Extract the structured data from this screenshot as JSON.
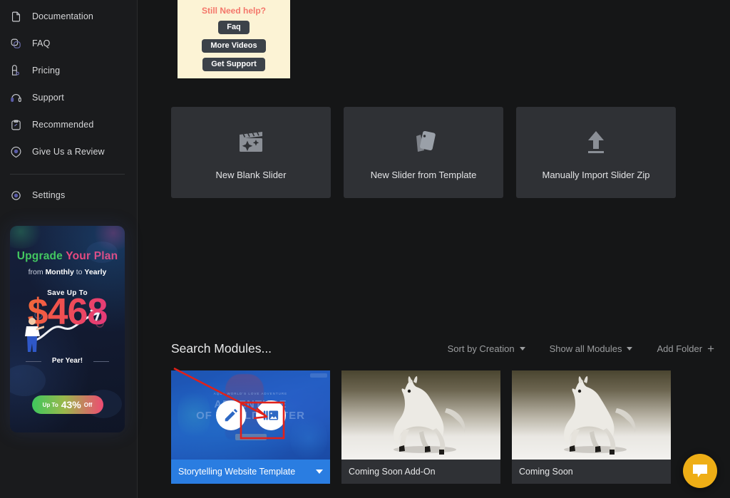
{
  "sidebar": {
    "items": [
      {
        "label": "Documentation",
        "icon": "document-icon"
      },
      {
        "label": "FAQ",
        "icon": "faq-icon"
      },
      {
        "label": "Pricing",
        "icon": "pricing-tag-icon"
      },
      {
        "label": "Support",
        "icon": "headset-icon"
      },
      {
        "label": "Recommended",
        "icon": "clipboard-icon"
      },
      {
        "label": "Give Us a Review",
        "icon": "review-bubble-icon"
      }
    ],
    "settings": {
      "label": "Settings",
      "icon": "gear-icon"
    },
    "promo": {
      "title_1": "Upgrade",
      "title_2": "Your Plan",
      "subtitle_pre": "from ",
      "subtitle_b1": "Monthly",
      "subtitle_mid": " to ",
      "subtitle_b2": "Yearly",
      "save_label": "Save Up To",
      "amount": "$468",
      "per_year": "Per Year!",
      "pill_pre": "Up To",
      "pill_value": "43%",
      "pill_post": "Off",
      "accent_green": "#43c760",
      "accent_pink": "#e8497f"
    }
  },
  "help_panel": {
    "title": "Still Need help?",
    "buttons": [
      "Faq",
      "More Videos",
      "Get Support"
    ],
    "bg_color": "#fcf3d5",
    "title_color": "#f4776b"
  },
  "actions": [
    {
      "label": "New Blank Slider",
      "icon": "clapperboard-sparkle-icon"
    },
    {
      "label": "New Slider from Template",
      "icon": "template-cards-icon"
    },
    {
      "label": "Manually Import Slider Zip",
      "icon": "upload-arrow-icon"
    }
  ],
  "toolbar": {
    "search_placeholder": "Search Modules...",
    "search_value": "",
    "sort_label": "Sort by Creation",
    "filter_label": "Show all Modules",
    "add_folder_label": "Add Folder",
    "add_folder_plus": "+"
  },
  "modules": [
    {
      "label": "Storytelling Website Template",
      "state": "hovered",
      "accent": "#2a7de1",
      "overlay_buttons": [
        "edit-pencil-icon",
        "slides-gallery-icon"
      ]
    },
    {
      "label": "Coming Soon Add-On",
      "state": "default",
      "thumb": "horse-image"
    },
    {
      "label": "Coming Soon",
      "state": "default",
      "thumb": "horse-image"
    }
  ],
  "chat": {
    "icon": "chat-bubble-icon",
    "color": "#eeae16"
  },
  "annotation": {
    "shape": "red-arrow-and-box",
    "color": "#e0211a"
  }
}
